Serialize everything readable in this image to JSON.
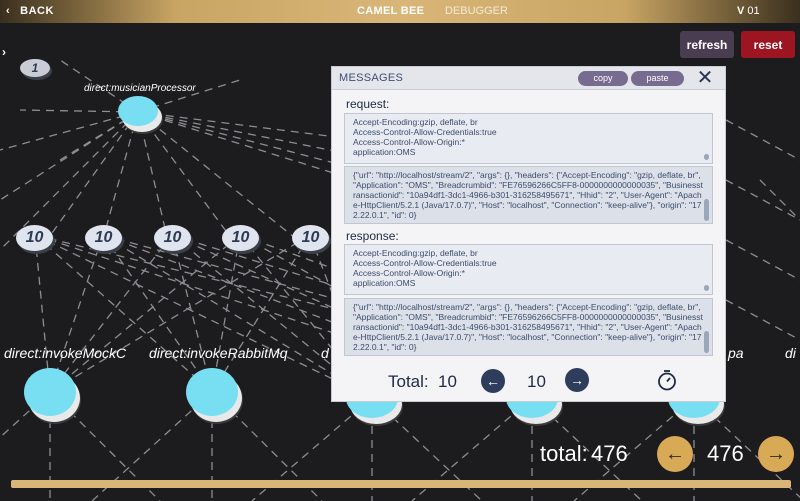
{
  "topbar": {
    "back_label": "BACK",
    "brand": "CAMEL BEE",
    "tab_debugger": "DEBUGGER",
    "version_prefix": "V",
    "version_number": "01"
  },
  "buttons": {
    "refresh": "refresh",
    "reset": "reset"
  },
  "graph": {
    "top_badge": "1",
    "top_node_label": "direct:musicianProcessor",
    "edge_badges": [
      "10",
      "10",
      "10",
      "10",
      "10"
    ],
    "bottom_labels": [
      "direct:invokeMockC",
      "direct:invokeRabbitMq",
      "d",
      "pa",
      "di"
    ]
  },
  "messages": {
    "title": "MESSAGES",
    "copy": "copy",
    "paste": "paste",
    "close_symbol": "✕",
    "request_label": "request:",
    "response_label": "response:",
    "request_headers": [
      "Accept-Encoding:gzip, deflate, br",
      "Access-Control-Allow-Credentials:true",
      "Access-Control-Allow-Origin:*",
      "application:OMS"
    ],
    "request_body": "{\"url\": \"http://localhost/stream/2\", \"args\": {}, \"headers\": {\"Accept-Encoding\": \"gzip, deflate, br\", \"Application\": \"OMS\", \"Breadcrumbid\": \"FE76596266C5FF8-0000000000000035\", \"Businesstransactionid\": \"10a94df1-3dc1-4966-b301-316258495671\", \"Hhid\": \"2\", \"User-Agent\": \"Apache-HttpClient/5.2.1 (Java/17.0.7)\", \"Host\": \"localhost\", \"Connection\": \"keep-alive\"}, \"origin\": \"172.22.0.1\", \"id\": 0}",
    "response_headers": [
      "Accept-Encoding:gzip, deflate, br",
      "Access-Control-Allow-Credentials:true",
      "Access-Control-Allow-Origin:*",
      "application:OMS"
    ],
    "response_body": "{\"url\": \"http://localhost/stream/2\", \"args\": {}, \"headers\": {\"Accept-Encoding\": \"gzip, deflate, br\", \"Application\": \"OMS\", \"Breadcrumbid\": \"FE76596266C5FF8-0000000000000035\", \"Businesstransactionid\": \"10a94df1-3dc1-4966-b301-316258495671\", \"Hhid\": \"2\", \"User-Agent\": \"Apache-HttpClient/5.2.1 (Java/17.0.7)\", \"Host\": \"localhost\", \"Connection\": \"keep-alive\"}, \"origin\": \"172.22.0.1\", \"id\": 0}",
    "total_label": "Total:",
    "total_value": "10",
    "page_value": "10",
    "prev_icon": "arrow-left-icon",
    "next_icon": "arrow-right-icon",
    "timer_icon": "stopwatch-icon"
  },
  "footer": {
    "total_label": "total:",
    "total_value": "476",
    "page_value": "476"
  },
  "colors": {
    "gold": "#d9b678",
    "reset_red": "#9c1520",
    "refresh_purple": "#4a3d52",
    "node_cyan": "#78dff3",
    "panel_navy": "#2f3d5c",
    "pill_purple": "#776b8f"
  }
}
